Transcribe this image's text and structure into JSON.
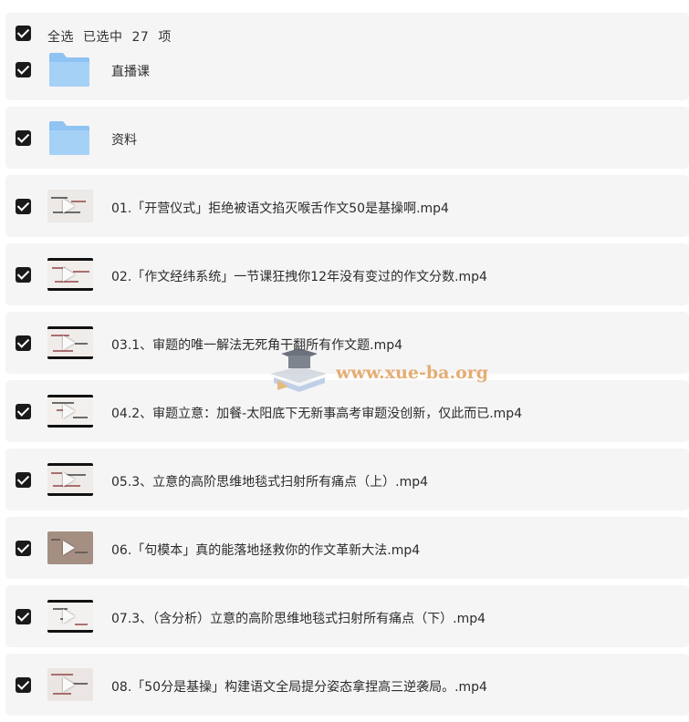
{
  "selection": {
    "select_all_label": "全选",
    "selected_prefix": "已选中",
    "selected_count": "27",
    "selected_suffix": "项"
  },
  "items": [
    {
      "type": "folder",
      "name": "直播课"
    },
    {
      "type": "folder",
      "name": "资料"
    },
    {
      "type": "video",
      "name": "01.「开营仪式」拒绝被语文掐灭喉舌作文50是基操啊.mp4"
    },
    {
      "type": "video",
      "name": "02.「作文经纬系统」一节课狂拽你12年没有变过的作文分数.mp4"
    },
    {
      "type": "video",
      "name": "03.1、审题的唯一解法无死角干翻所有作文题.mp4"
    },
    {
      "type": "video",
      "name": "04.2、审题立意：加餐-太阳底下无新事高考审题没创新，仅此而已.mp4"
    },
    {
      "type": "video",
      "name": "05.3、立意的高阶思维地毯式扫射所有痛点（上）.mp4"
    },
    {
      "type": "video",
      "name": "06.「句模本」真的能落地拯救你的作文革新大法.mp4"
    },
    {
      "type": "video",
      "name": "07.3、（含分析）立意的高阶思维地毯式扫射所有痛点（下）.mp4"
    },
    {
      "type": "video",
      "name": "08.「50分是基操」构建语文全局提分姿态拿捏高三逆袭局。.mp4"
    }
  ],
  "watermark": {
    "text": "www.xue-ba.org"
  },
  "colors": {
    "row_bg": "#f5f5f6",
    "checkbox": "#1a1a1a",
    "folder": "#8ec3f2",
    "watermark": "#e2a05c"
  }
}
